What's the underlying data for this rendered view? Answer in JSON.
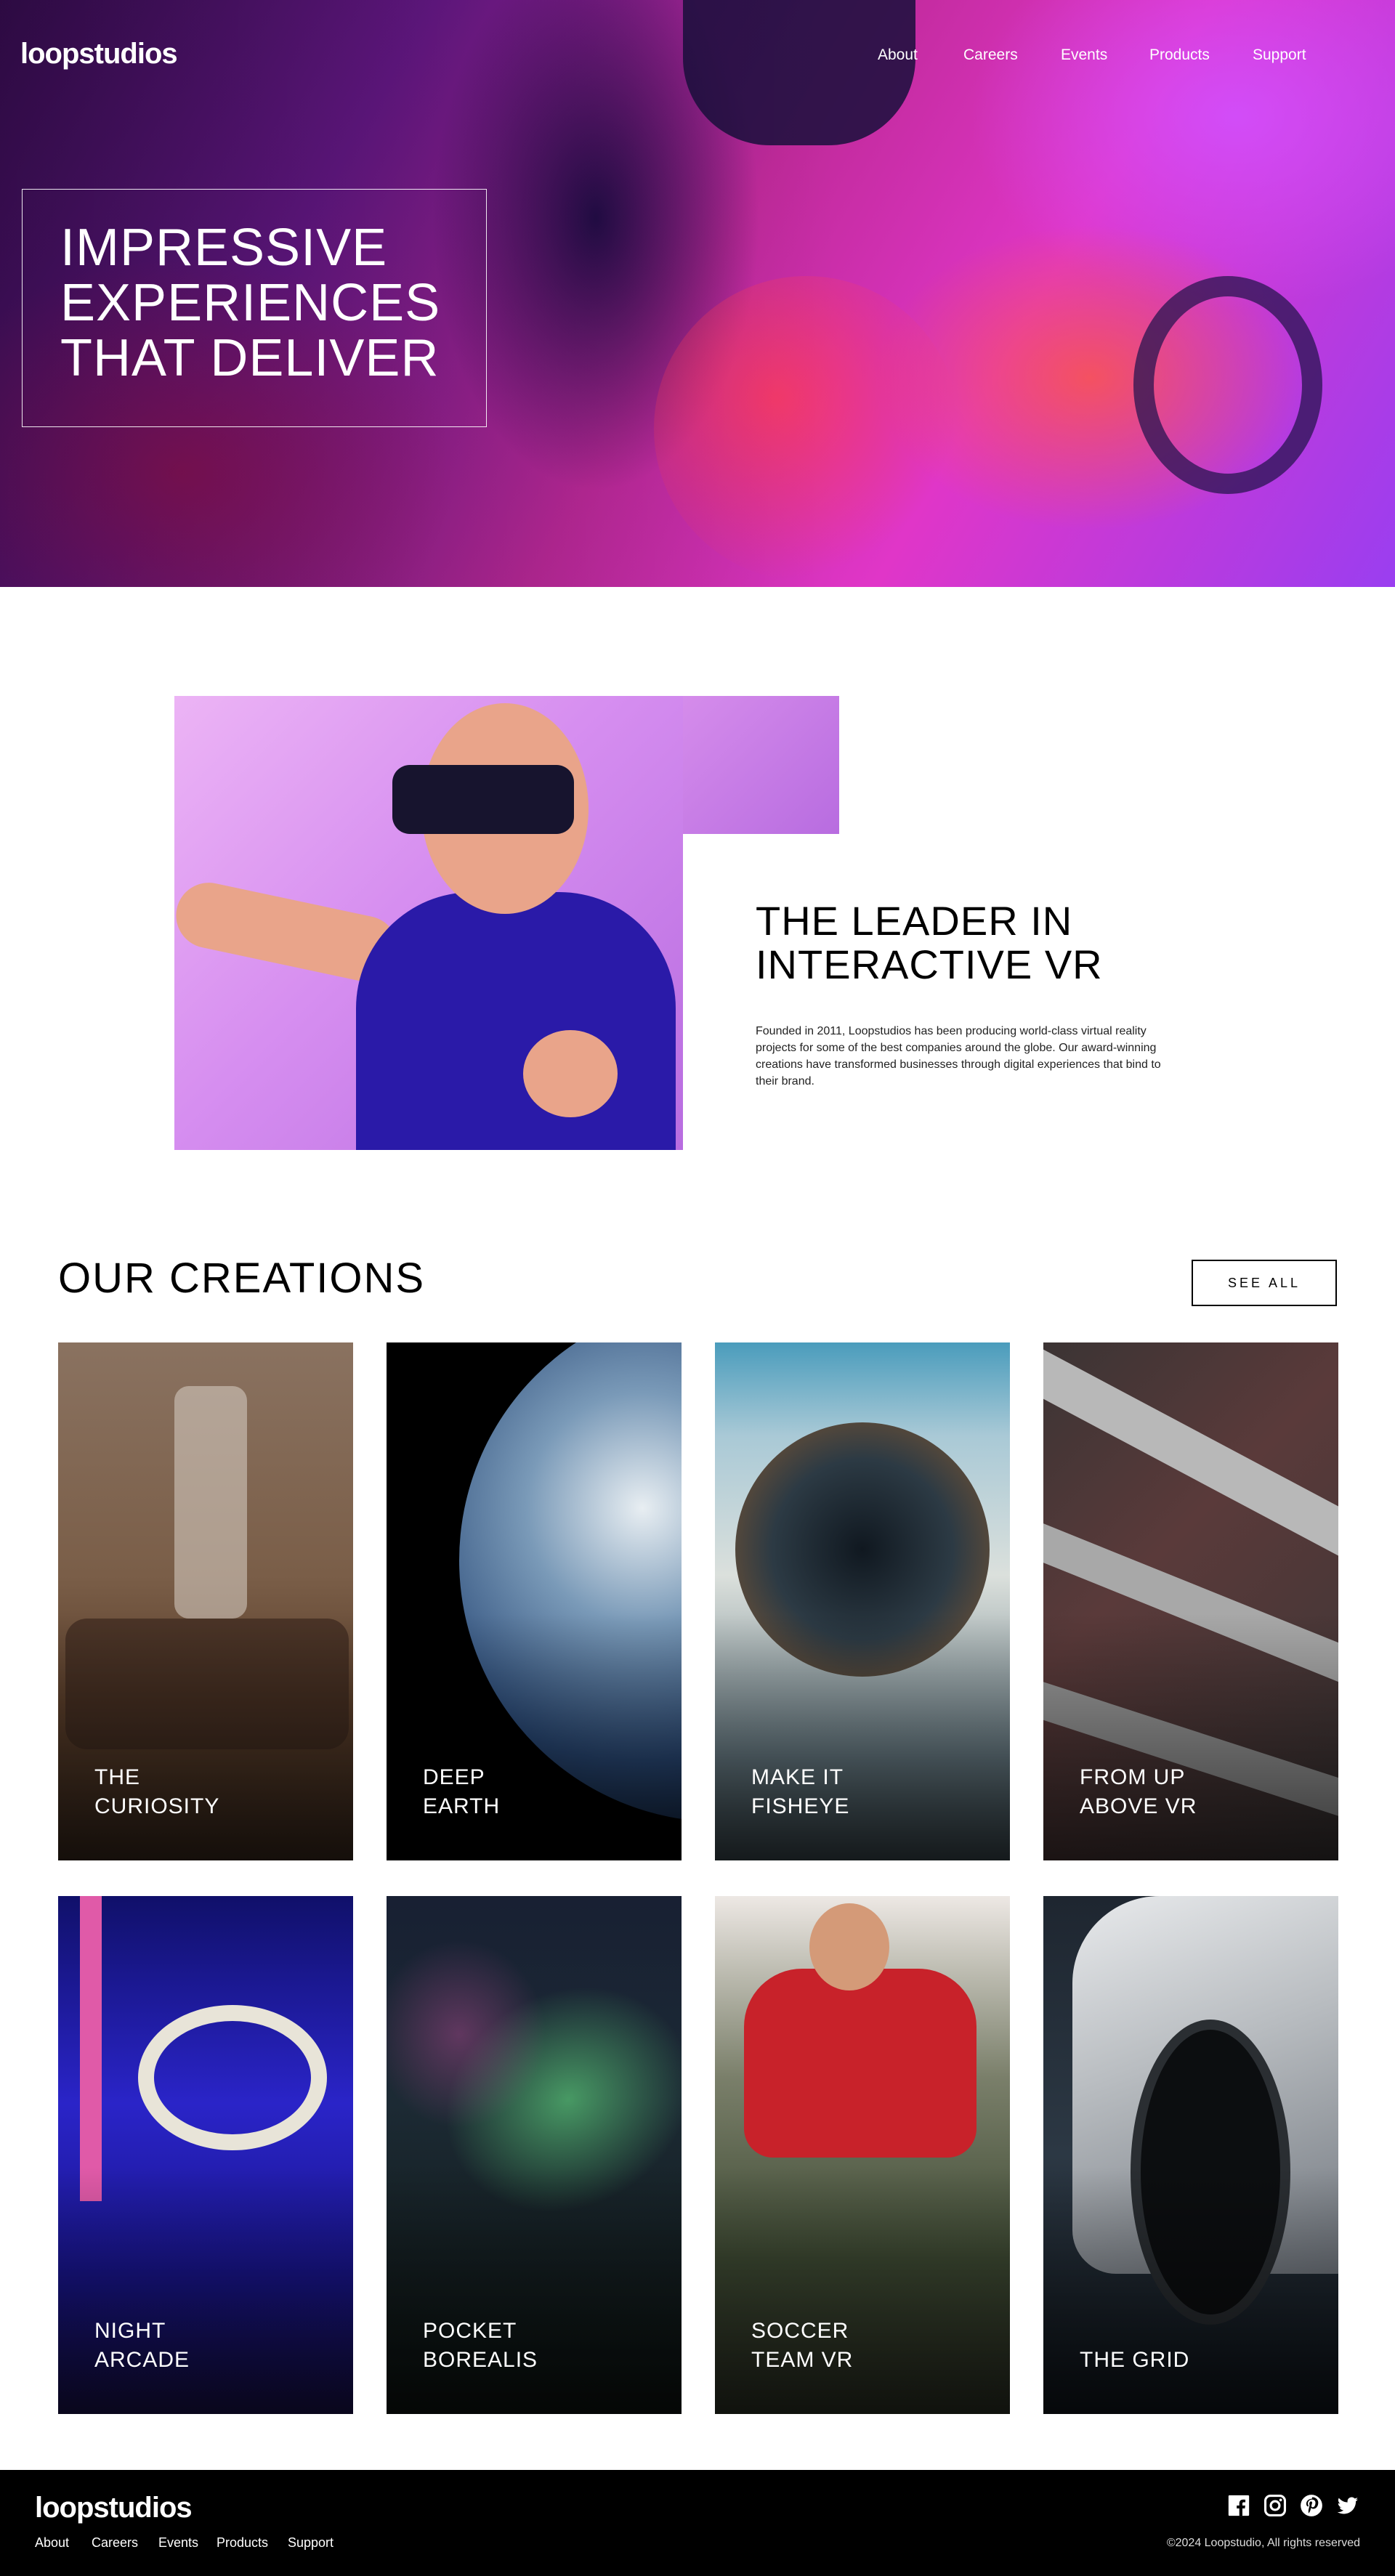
{
  "header": {
    "logo": "loopstudios",
    "nav": [
      "About",
      "Careers",
      "Events",
      "Products",
      "Support"
    ]
  },
  "hero": {
    "title_lines": [
      "IMPRESSIVE",
      "EXPERIENCES",
      "THAT DELIVER"
    ]
  },
  "intro": {
    "title_lines": [
      "THE LEADER IN",
      "INTERACTIVE VR"
    ],
    "text": "Founded in 2011, Loopstudios has been producing world-class virtual reality projects for some of the best companies around the globe. Our award-winning creations have transformed businesses through digital experiences that bind to their brand."
  },
  "creations": {
    "title": "OUR CREATIONS",
    "see_all": "SEE ALL",
    "items": [
      {
        "line1": "THE",
        "line2": "CURIOSITY"
      },
      {
        "line1": "DEEP",
        "line2": "EARTH"
      },
      {
        "line1": "MAKE IT",
        "line2": "FISHEYE"
      },
      {
        "line1": "FROM UP",
        "line2": "ABOVE VR"
      },
      {
        "line1": "NIGHT",
        "line2": "ARCADE"
      },
      {
        "line1": "POCKET",
        "line2": "BOREALIS"
      },
      {
        "line1": "SOCCER",
        "line2": "TEAM VR"
      },
      {
        "line1": "",
        "line2": "THE GRID"
      }
    ]
  },
  "footer": {
    "logo": "loopstudios",
    "nav": [
      "About",
      "Careers",
      "Events",
      "Products",
      "Support"
    ],
    "social_icons": [
      "facebook-icon",
      "instagram-icon",
      "pinterest-icon",
      "twitter-icon"
    ],
    "copyright": "©2024 Loopstudio, All rights reserved"
  },
  "colors": {
    "text_dark": "#000000",
    "footer_bg": "#000000",
    "hero_accent": "#e036c8"
  }
}
